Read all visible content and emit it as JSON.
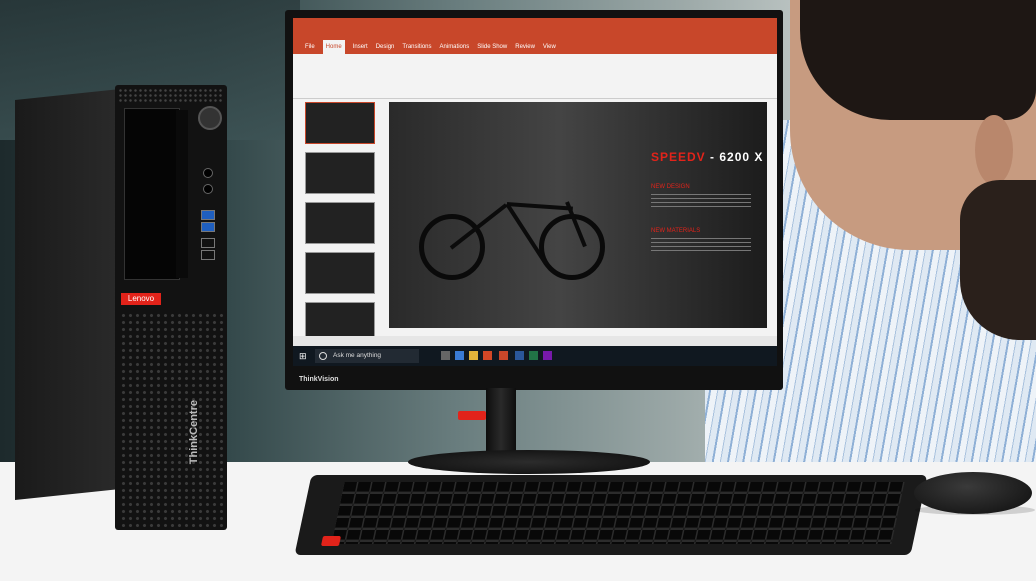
{
  "tower": {
    "brand_badge": "Lenovo",
    "model_label": "ThinkCentre"
  },
  "monitor": {
    "brand_label": "ThinkVision",
    "app": {
      "ribbon_tabs": [
        "File",
        "Home",
        "Insert",
        "Design",
        "Transitions",
        "Animations",
        "Slide Show",
        "Review",
        "View"
      ],
      "slide_title_accent": "SPEEDV",
      "slide_title_rest": " - 6200 X",
      "slide_heading_1": "NEW DESIGN",
      "slide_heading_2": "NEW MATERIALS"
    },
    "taskbar": {
      "search_placeholder": "Ask me anything"
    }
  },
  "colors": {
    "lenovo_red": "#e2231a",
    "powerpoint_orange": "#c8472a",
    "taskbar_dark": "#101820"
  }
}
